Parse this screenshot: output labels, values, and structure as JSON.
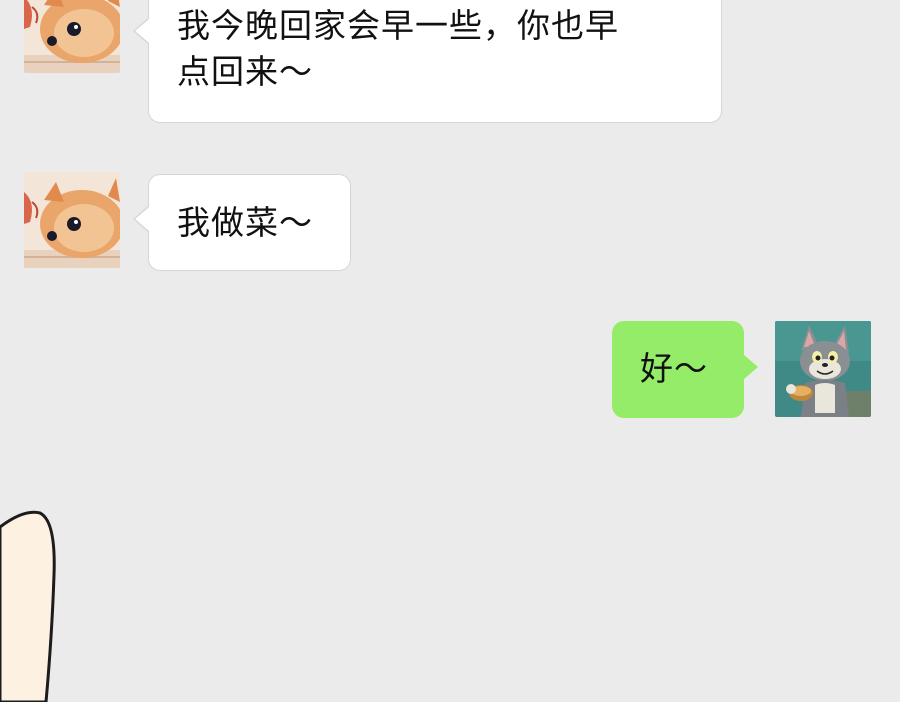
{
  "chat": {
    "messages": [
      {
        "sender": "other",
        "avatar": "cat-avatar",
        "line1": "我今晚回家会早一些，你也早",
        "line2": "点回来～"
      },
      {
        "sender": "other",
        "avatar": "cat-avatar",
        "text": "我做菜～"
      },
      {
        "sender": "self",
        "avatar": "tom-cat-avatar",
        "text": "好～"
      }
    ]
  },
  "colors": {
    "background": "#ebebeb",
    "incoming_bubble": "#ffffff",
    "outgoing_bubble": "#95ec69",
    "text": "#111111"
  }
}
